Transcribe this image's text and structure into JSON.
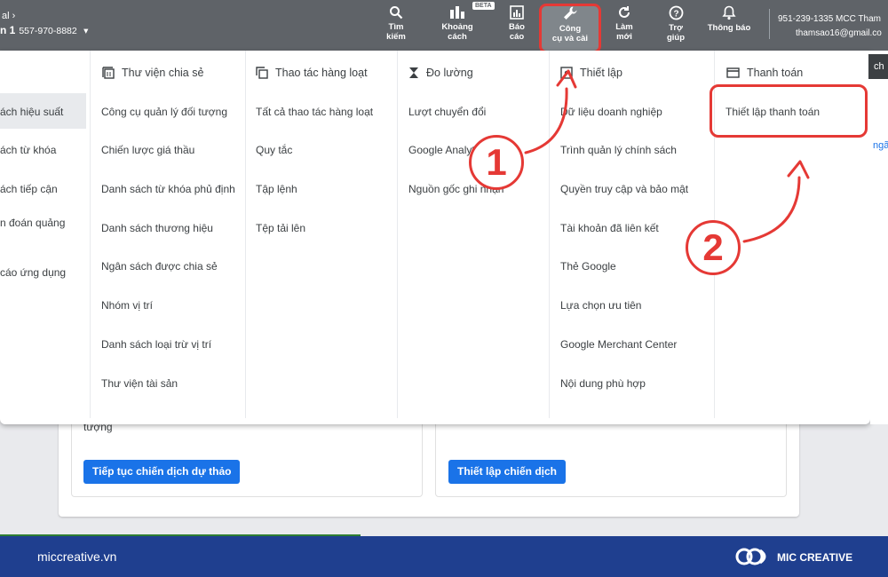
{
  "topbar": {
    "account_prefix": "al",
    "account_name": "n 1",
    "account_id": "557-970-8882",
    "nav": [
      {
        "label_line1": "Tìm",
        "label_line2": "kiếm",
        "icon": "search-icon"
      },
      {
        "label_line1": "Khoảng",
        "label_line2": "cách",
        "icon": "gap-icon",
        "badge": "BETA"
      },
      {
        "label_line1": "Báo",
        "label_line2": "cáo",
        "icon": "report-icon"
      },
      {
        "label_line1": "Công",
        "label_line2": "cụ và cài",
        "icon": "wrench-icon"
      },
      {
        "label_line1": "Làm",
        "label_line2": "mới",
        "icon": "refresh-icon"
      },
      {
        "label_line1": "Trợ",
        "label_line2": "giúp",
        "icon": "help-icon"
      },
      {
        "label_line1": "Thông báo",
        "label_line2": "",
        "icon": "bell-icon"
      }
    ],
    "right_line1": "951-239-1335 MCC Tham",
    "right_line2": "thamsao16@gmail.co"
  },
  "sidebar_items": [
    "ách hiệu suất",
    "ách từ khóa",
    "ách tiếp cận",
    "n đoán quảng",
    "cáo ứng dụng"
  ],
  "columns": [
    {
      "title": "Thư viện chia sẻ",
      "icon": "library-icon",
      "items": [
        "Công cụ quản lý đối tượng",
        "Chiến lược giá thầu",
        "Danh sách từ khóa phủ định",
        "Danh sách thương hiệu",
        "Ngân sách được chia sẻ",
        "Nhóm vị trí",
        "Danh sách loại trừ vị trí",
        "Thư viện tài sản"
      ]
    },
    {
      "title": "Thao tác hàng loạt",
      "icon": "bulk-icon",
      "items": [
        "Tất cả thao tác hàng loạt",
        "Quy tắc",
        "Tập lệnh",
        "Tệp tải lên"
      ]
    },
    {
      "title": "Đo lường",
      "icon": "hourglass-icon",
      "items": [
        "Lượt chuyển đổi",
        "Google Analytics",
        "Nguồn gốc ghi nhận"
      ]
    },
    {
      "title": "Thiết lập",
      "icon": "settings-icon",
      "items": [
        "Dữ liệu doanh nghiệp",
        "Trình quản lý chính sách",
        "Quyền truy cập và bảo mật",
        "Tài khoản đã liên kết",
        "Thẻ Google",
        "Lựa chọn ưu tiên",
        "Google Merchant Center",
        "Nội dung phù hợp"
      ]
    },
    {
      "title": "Thanh toán",
      "icon": "card-icon",
      "items": [
        "Thiết lập thanh toán"
      ]
    }
  ],
  "edge": {
    "dark": "ch",
    "blue": "ngã"
  },
  "background": {
    "card_text": "tượng",
    "btn1": "Tiếp tục chiến dịch dự thảo",
    "btn2": "Thiết lập chiến dịch"
  },
  "annotations": {
    "step1": "1",
    "step2": "2"
  },
  "footer": {
    "site": "miccreative.vn",
    "brand": "MIC CREATIVE"
  }
}
